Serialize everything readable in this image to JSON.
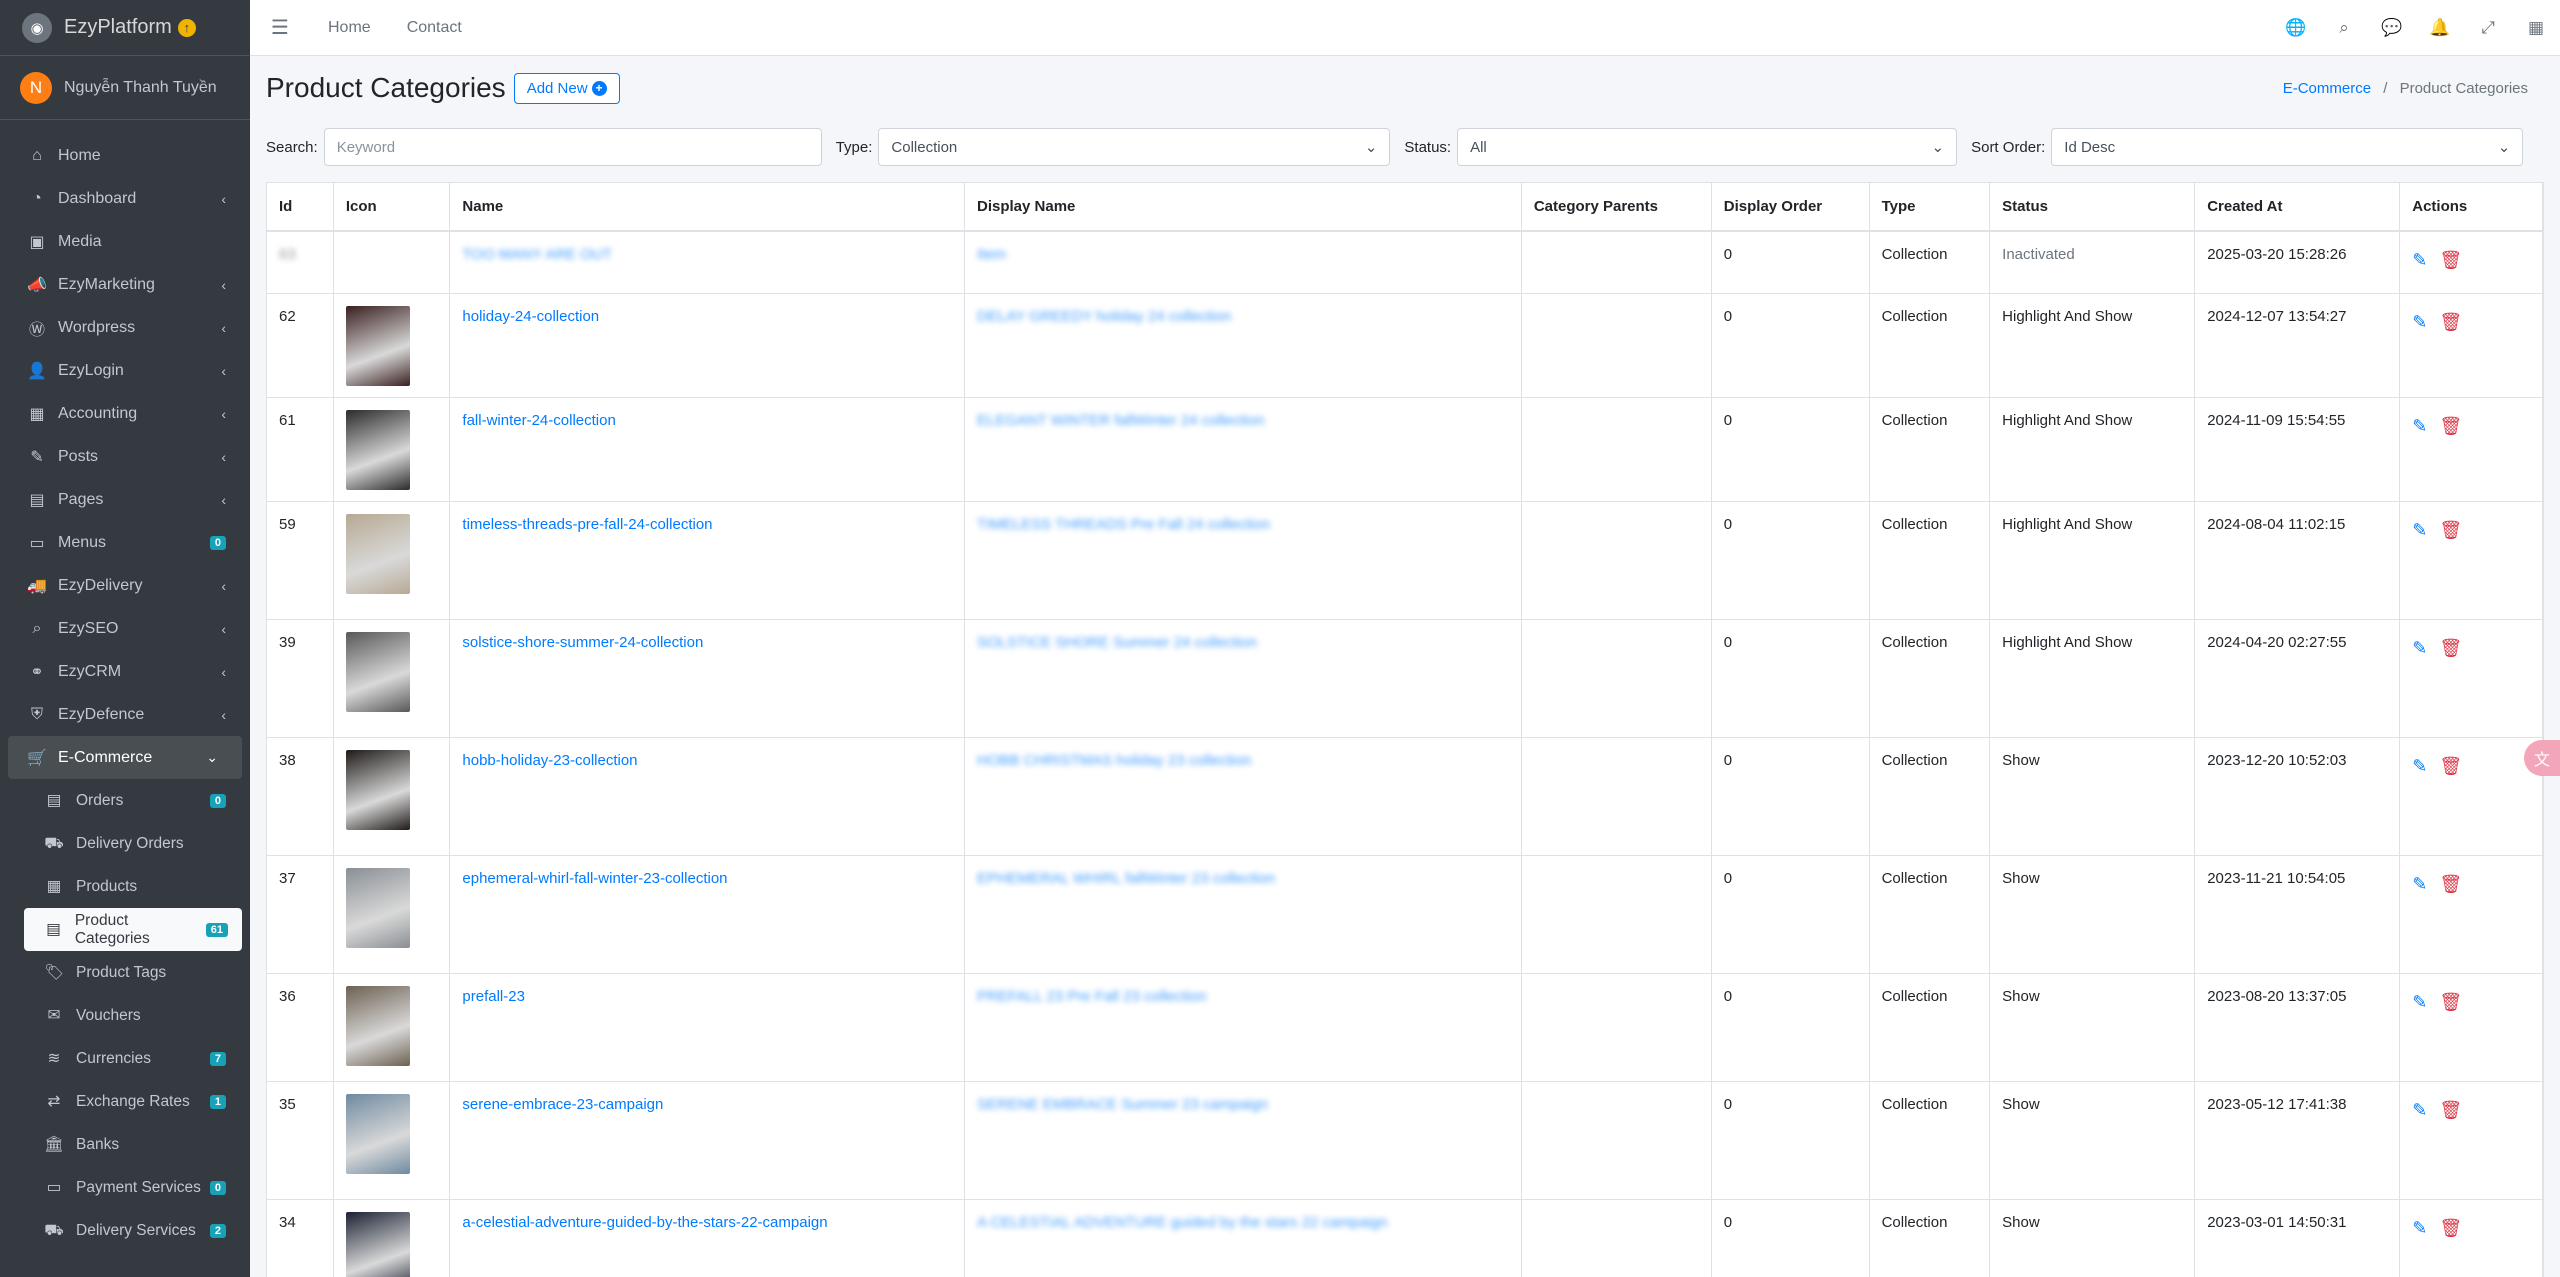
{
  "brand": {
    "name": "EzyPlatform",
    "logo_icon": "globe-logo-icon",
    "update_icon": "arrow-up-circle-icon"
  },
  "user": {
    "initial": "N",
    "name": "Nguyễn Thanh Tuyền"
  },
  "sidebar": {
    "items": [
      {
        "label": "Home",
        "icon": "⌂",
        "chev": ""
      },
      {
        "label": "Dashboard",
        "icon": "◔",
        "chev": "‹"
      },
      {
        "label": "Media",
        "icon": "▣",
        "chev": ""
      },
      {
        "label": "EzyMarketing",
        "icon": "📣",
        "chev": "‹"
      },
      {
        "label": "Wordpress",
        "icon": "Ⓦ",
        "chev": "‹"
      },
      {
        "label": "EzyLogin",
        "icon": "👤",
        "chev": "‹"
      },
      {
        "label": "Accounting",
        "icon": "▦",
        "chev": "‹"
      },
      {
        "label": "Posts",
        "icon": "✎",
        "chev": "‹"
      },
      {
        "label": "Pages",
        "icon": "▤",
        "chev": "‹"
      },
      {
        "label": "Menus",
        "icon": "▭",
        "badge": "0"
      },
      {
        "label": "EzyDelivery",
        "icon": "🚚",
        "chev": "‹"
      },
      {
        "label": "EzySEO",
        "icon": "⌕",
        "chev": "‹"
      },
      {
        "label": "EzyCRM",
        "icon": "⚭",
        "chev": "‹"
      },
      {
        "label": "EzyDefence",
        "icon": "⛨",
        "chev": "‹"
      },
      {
        "label": "E-Commerce",
        "icon": "🛒",
        "chev": "⌄"
      }
    ],
    "sub_items": [
      {
        "label": "Orders",
        "icon": "▤",
        "badge": "0"
      },
      {
        "label": "Delivery Orders",
        "icon": "⛟"
      },
      {
        "label": "Products",
        "icon": "▦"
      },
      {
        "label": "Product Categories",
        "icon": "▤",
        "badge": "61"
      },
      {
        "label": "Product Tags",
        "icon": "🏷"
      },
      {
        "label": "Vouchers",
        "icon": "✉"
      },
      {
        "label": "Currencies",
        "icon": "≋",
        "badge": "7"
      },
      {
        "label": "Exchange Rates",
        "icon": "⇄",
        "badge": "1"
      },
      {
        "label": "Banks",
        "icon": "🏛"
      },
      {
        "label": "Payment Services",
        "icon": "▭",
        "badge": "0"
      },
      {
        "label": "Delivery Services",
        "icon": "⛟",
        "badge": "2"
      }
    ]
  },
  "topbar": {
    "home": "Home",
    "contact": "Contact"
  },
  "page": {
    "title": "Product Categories",
    "add_new": "Add New",
    "breadcrumb_parent": "E-Commerce",
    "breadcrumb_sep": "/",
    "breadcrumb_current": "Product Categories"
  },
  "filters": {
    "search_label": "Search:",
    "search_placeholder": "Keyword",
    "type_label": "Type:",
    "type_value": "Collection",
    "status_label": "Status:",
    "status_value": "All",
    "sort_label": "Sort Order:",
    "sort_value": "Id Desc"
  },
  "table": {
    "headers": [
      "Id",
      "Icon",
      "Name",
      "Display Name",
      "Category Parents",
      "Display Order",
      "Type",
      "Status",
      "Created At",
      "Actions"
    ],
    "rows": [
      {
        "id": "63",
        "name": "TOO MANY ARE OUT",
        "display": "Item",
        "order": "0",
        "type": "Collection",
        "status": "Inactivated",
        "created": "2025-03-20 15:28:26",
        "blur_name": true,
        "img": ""
      },
      {
        "id": "62",
        "name": "holiday-24-collection",
        "display": "DELAY GREEDY holiday 24 collection",
        "order": "0",
        "type": "Collection",
        "status": "Highlight And Show",
        "created": "2024-12-07 13:54:27",
        "img": "#3a1f1f"
      },
      {
        "id": "61",
        "name": "fall-winter-24-collection",
        "display": "ELEGANT WINTER fallWinter 24 collection",
        "order": "0",
        "type": "Collection",
        "status": "Highlight And Show",
        "created": "2024-11-09 15:54:55",
        "img": "#2b2b2b"
      },
      {
        "id": "59",
        "name": "timeless-threads-pre-fall-24-collection",
        "display": "TIMELESS THREADS Pre Fall 24 collection",
        "order": "0",
        "type": "Collection",
        "status": "Highlight And Show",
        "created": "2024-08-04 11:02:15",
        "img": "#b7a993"
      },
      {
        "id": "39",
        "name": "solstice-shore-summer-24-collection",
        "display": "SOLSTICE SHORE Summer 24 collection",
        "order": "0",
        "type": "Collection",
        "status": "Highlight And Show",
        "created": "2024-04-20 02:27:55",
        "img": "#585858"
      },
      {
        "id": "38",
        "name": "hobb-holiday-23-collection",
        "display": "HOBB CHRISTMAS holiday 23 collection",
        "order": "0",
        "type": "Collection",
        "status": "Show",
        "created": "2023-12-20 10:52:03",
        "img": "#1e1a18"
      },
      {
        "id": "37",
        "name": "ephemeral-whirl-fall-winter-23-collection",
        "display": "EPHEMERAL WHIRL fallWinter 23 collection",
        "order": "0",
        "type": "Collection",
        "status": "Show",
        "created": "2023-11-21 10:54:05",
        "img": "#8a8f94"
      },
      {
        "id": "36",
        "name": "prefall-23",
        "display": "PREFALL 23 Pre Fall 23 collection",
        "order": "0",
        "type": "Collection",
        "status": "Show",
        "created": "2023-08-20 13:37:05",
        "img": "#6d6152"
      },
      {
        "id": "35",
        "name": "serene-embrace-23-campaign",
        "display": "SERENE EMBRACE Summer 23 campaign",
        "order": "0",
        "type": "Collection",
        "status": "Show",
        "created": "2023-05-12 17:41:38",
        "img": "#6f8aa0"
      },
      {
        "id": "34",
        "name": "a-celestial-adventure-guided-by-the-stars-22-campaign",
        "display": "A CELESTIAL ADVENTURE guided by the stars 22 campaign",
        "order": "0",
        "type": "Collection",
        "status": "Show",
        "created": "2023-03-01 14:50:31",
        "img": "#1b2233"
      }
    ]
  },
  "colors": {
    "sidebar": "#343a40",
    "accent": "#007bff",
    "danger": "#dc3545",
    "badge": "#17a2b8"
  }
}
